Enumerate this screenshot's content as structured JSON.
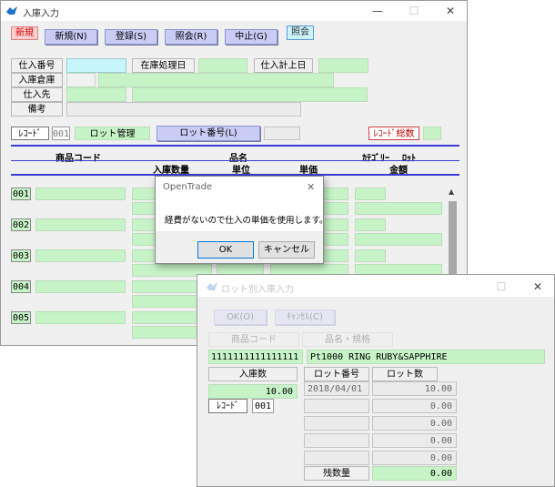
{
  "main": {
    "title": "入庫入力",
    "window_buttons": {
      "minimize": "—",
      "maximize": "☐",
      "close": "✕"
    },
    "mode_badge": "新規",
    "toolbar": {
      "new": "新規(N)",
      "register": "登録(S)",
      "inquiry": "照会(R)",
      "cancel": "中止(G)"
    },
    "mode_indicator": "照会",
    "form": {
      "order_no_label": "仕入番号",
      "stock_date_label": "在庫処理日",
      "purchase_date_label": "仕入計上日",
      "warehouse_label": "入庫倉庫",
      "supplier_label": "仕入先",
      "memo_label": "備考"
    },
    "record_label": "ﾚｺｰﾄﾞ",
    "record_no": "001",
    "lot_mgmt": "ロット管理",
    "lot_no_button": "ロット番号(L)",
    "record_total_label": "ﾚｺｰﾄﾞ総数",
    "headers": {
      "product_code": "商品コード",
      "product_name": "品名",
      "category": "ｶﾃｺﾞﾘｰ",
      "lot": "ﾛｯﾄ",
      "qty": "入庫数量",
      "unit": "単位",
      "unit_price": "単価",
      "amount": "金額"
    },
    "rows": [
      "001",
      "002",
      "003",
      "004",
      "005"
    ],
    "scroll_up": "▲"
  },
  "dialog": {
    "title": "OpenTrade",
    "close": "✕",
    "message": "経費がないので仕入の単価を使用します。",
    "ok": "OK",
    "cancel": "キャンセル"
  },
  "lot": {
    "title": "ロット別入庫入力",
    "window_buttons": {
      "maximize": "☐",
      "close": "✕"
    },
    "btn_ok": "OK(O)",
    "btn_cancel": "ｷｬﾝｾﾙ(C)",
    "product_code_label": "商品コード",
    "product_name_label": "品名・規格",
    "product_code": "1111111111111111",
    "product_name": "Pt1000 RING RUBY&SAPPHIRE",
    "stock_qty_label": "入庫数",
    "lot_no_label": "ロット番号",
    "lot_qty_label": "ロット数",
    "stock_qty": "10.00",
    "record_label": "ﾚｺｰﾄﾞ",
    "record_no": "001",
    "lots": [
      {
        "no": "2018/04/01",
        "qty": "10.00"
      },
      {
        "no": "",
        "qty": "0.00"
      },
      {
        "no": "",
        "qty": "0.00"
      },
      {
        "no": "",
        "qty": "0.00"
      },
      {
        "no": "",
        "qty": "0.00"
      }
    ],
    "remaining_label": "残数量",
    "remaining": "0.00"
  },
  "colors": {
    "field_green": "#c6f4c6",
    "button_blue": "#c9cdf6",
    "header_line": "#3c3cd6",
    "cyan_field": "#c6f6fb"
  }
}
